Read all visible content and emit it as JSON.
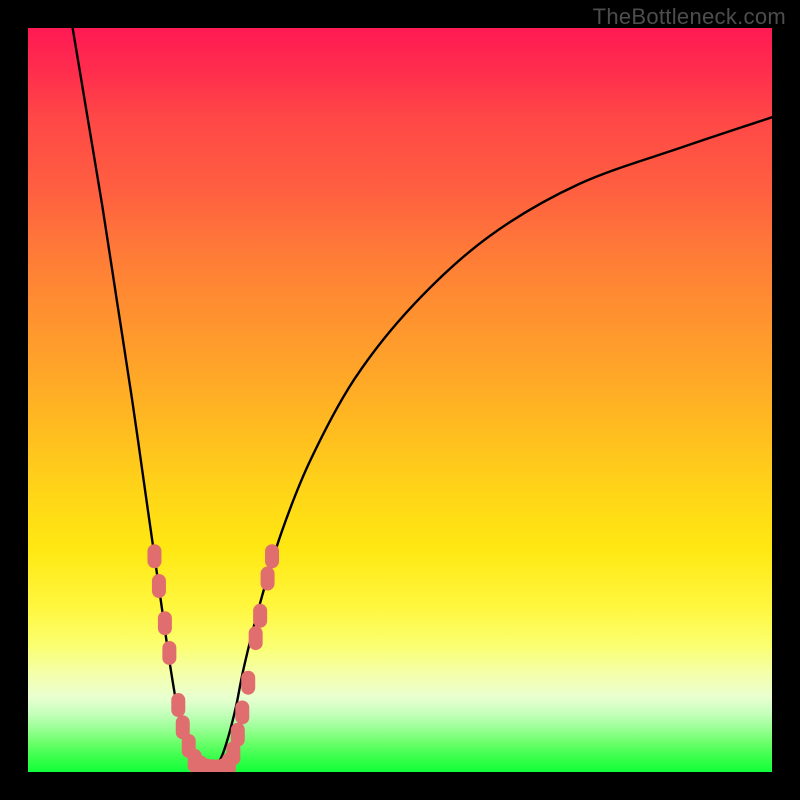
{
  "watermark": "TheBottleneck.com",
  "colors": {
    "frame": "#000000",
    "curve": "#000000",
    "beads": "#e06e6e",
    "gradient_top": "#ff1a53",
    "gradient_bottom": "#12ff3a"
  },
  "chart_data": {
    "type": "line",
    "title": "",
    "xlabel": "",
    "ylabel": "",
    "xlim": [
      0,
      100
    ],
    "ylim": [
      0,
      100
    ],
    "note": "No numeric tick labels or axis labels are visible in the image. The chart depicts a bottleneck/V-shaped pair of curves over a rainbow vertical gradient (red=high bottleneck, green=low). Curve y-values below are read off as percentage of plot height from bottom; x-values as percentage of plot width from left.",
    "series": [
      {
        "name": "left-curve",
        "x": [
          6,
          8,
          10,
          12,
          14,
          16,
          17,
          18,
          19,
          20,
          21,
          22,
          23,
          24
        ],
        "y": [
          100,
          88,
          76,
          63,
          50,
          36,
          29,
          22,
          15,
          9,
          5,
          2,
          0.7,
          0
        ]
      },
      {
        "name": "right-curve",
        "x": [
          24,
          25,
          26,
          27,
          28,
          29,
          31,
          34,
          38,
          44,
          52,
          62,
          74,
          88,
          100
        ],
        "y": [
          0,
          0.5,
          2,
          5,
          9,
          14,
          22,
          32,
          42,
          53,
          63,
          72,
          79,
          84,
          88
        ]
      }
    ],
    "beads": {
      "note": "Coral-colored overlapping capsule/bead markers clustered near the bottom of each curve arm.",
      "left_arm": [
        {
          "x": 17.0,
          "y": 29
        },
        {
          "x": 17.6,
          "y": 25
        },
        {
          "x": 18.4,
          "y": 20
        },
        {
          "x": 19.0,
          "y": 16
        },
        {
          "x": 20.2,
          "y": 9
        },
        {
          "x": 20.8,
          "y": 6
        },
        {
          "x": 21.6,
          "y": 3.5
        },
        {
          "x": 22.4,
          "y": 1.5
        },
        {
          "x": 23.2,
          "y": 0.6
        },
        {
          "x": 24.0,
          "y": 0.2
        },
        {
          "x": 24.8,
          "y": 0.1
        },
        {
          "x": 25.6,
          "y": 0.1
        }
      ],
      "right_arm": [
        {
          "x": 26.4,
          "y": 0.3
        },
        {
          "x": 27.0,
          "y": 1
        },
        {
          "x": 27.6,
          "y": 2.5
        },
        {
          "x": 28.2,
          "y": 5
        },
        {
          "x": 28.8,
          "y": 8
        },
        {
          "x": 29.6,
          "y": 12
        },
        {
          "x": 30.6,
          "y": 18
        },
        {
          "x": 31.2,
          "y": 21
        },
        {
          "x": 32.2,
          "y": 26
        },
        {
          "x": 32.8,
          "y": 29
        }
      ]
    }
  }
}
